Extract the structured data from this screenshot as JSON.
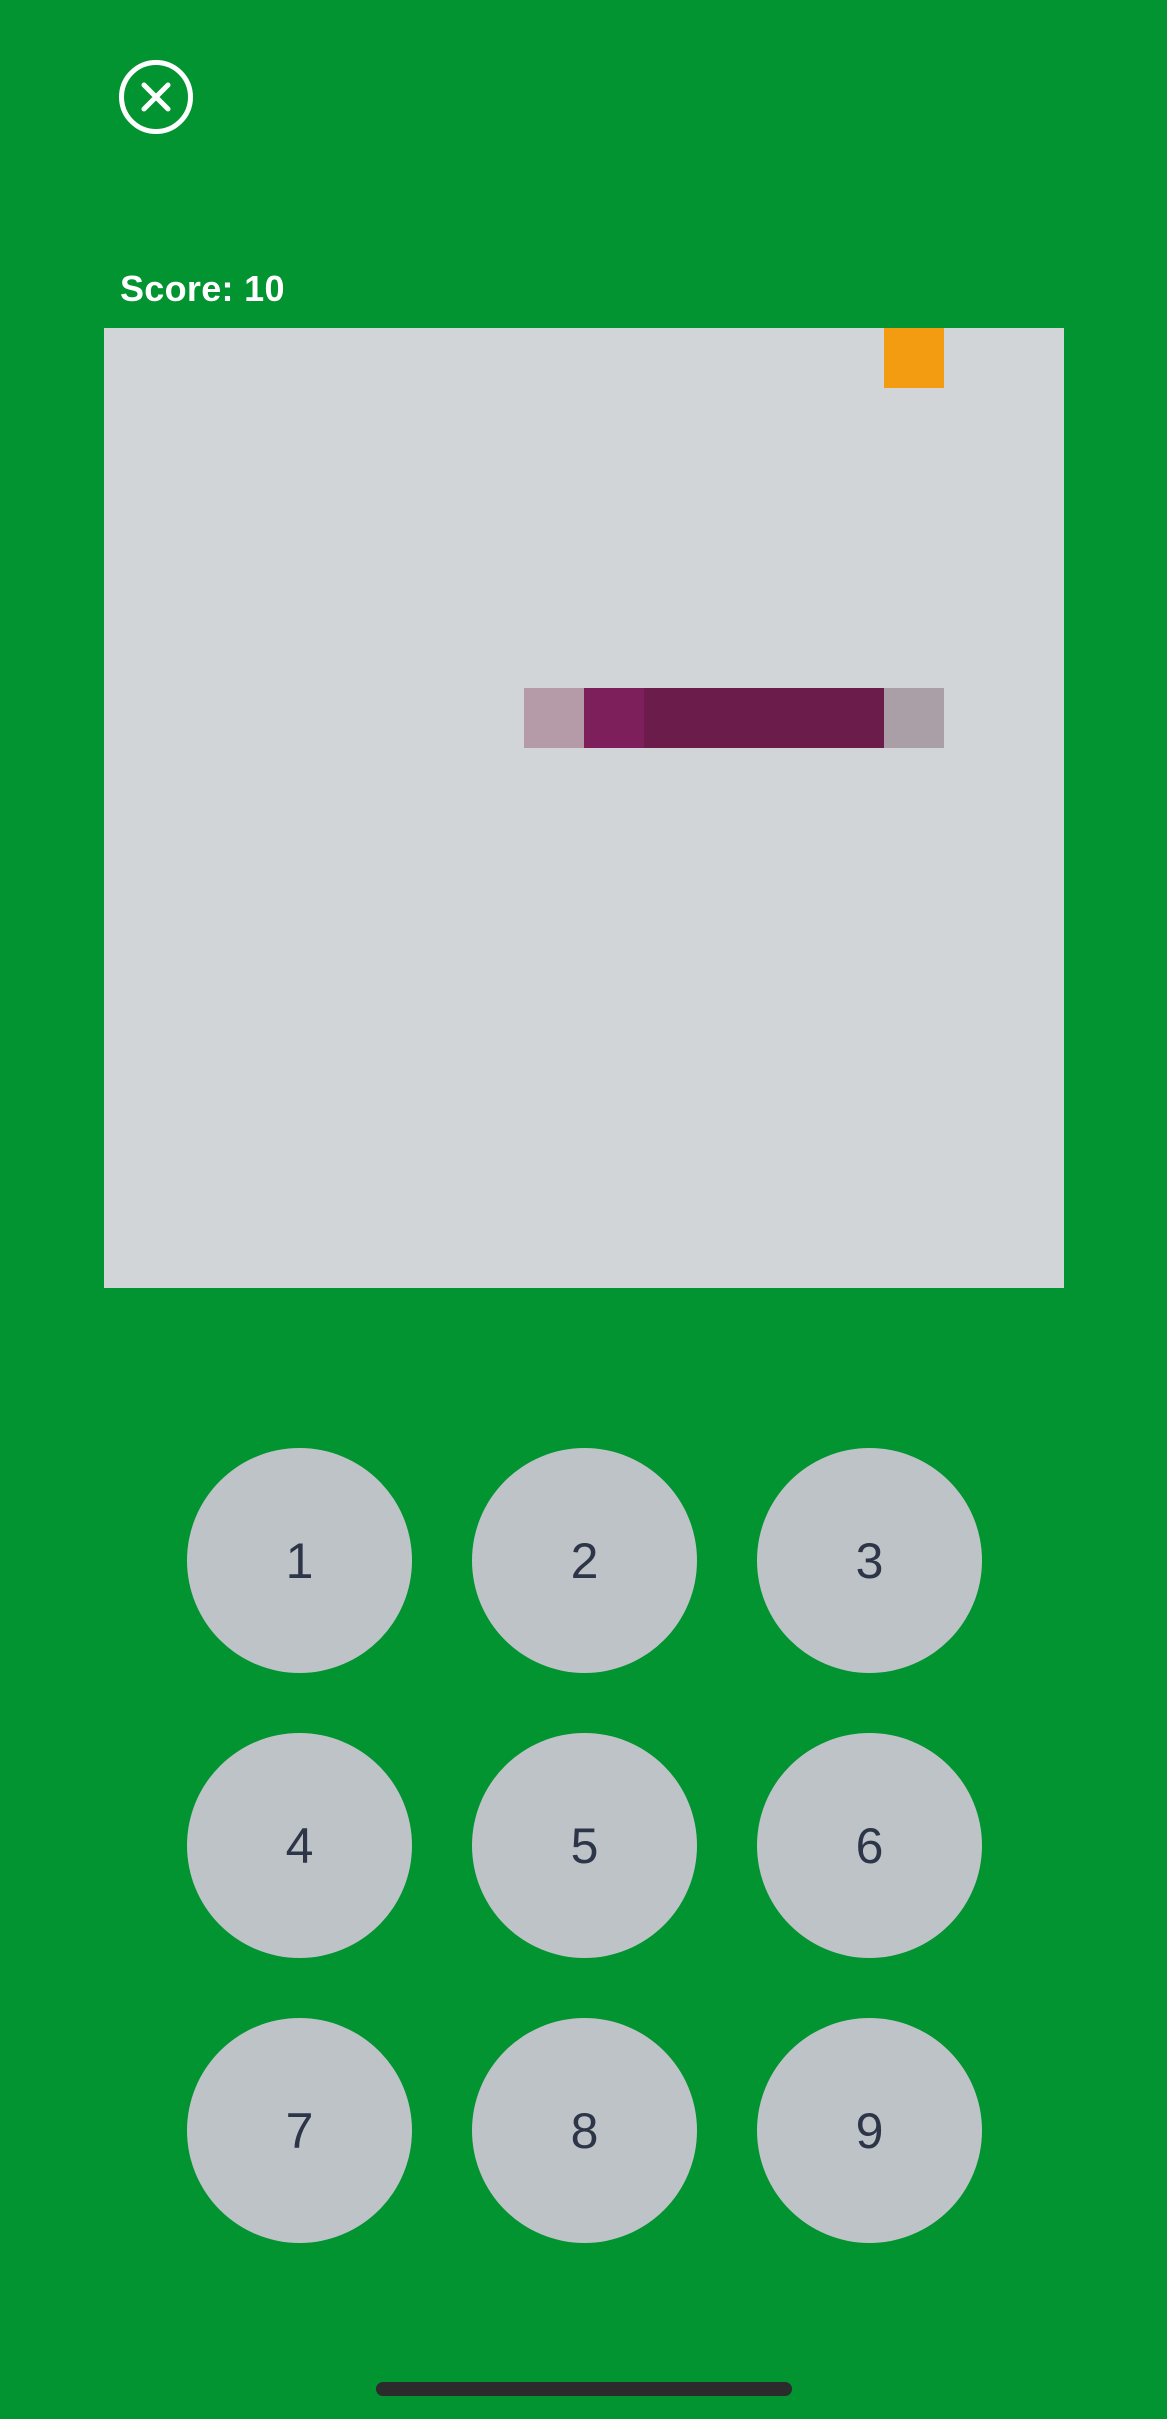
{
  "header": {
    "close_icon": "close-circle-icon",
    "score_text": "Score: 10"
  },
  "game": {
    "grid_size": 16,
    "food": {
      "col": 13,
      "row": 0,
      "color": "#f39c12"
    },
    "snake": [
      {
        "col": 7,
        "row": 6,
        "color": "#b59aa8"
      },
      {
        "col": 8,
        "row": 6,
        "color": "#7d1f5b"
      },
      {
        "col": 9,
        "row": 6,
        "color": "#6b1c4a"
      },
      {
        "col": 10,
        "row": 6,
        "color": "#6b1c4a"
      },
      {
        "col": 11,
        "row": 6,
        "color": "#6b1c4a"
      },
      {
        "col": 12,
        "row": 6,
        "color": "#6b1c4a"
      },
      {
        "col": 13,
        "row": 6,
        "color": "#aa9fa6"
      }
    ],
    "board_color": "#d1d5d7"
  },
  "keypad": {
    "keys": [
      "1",
      "2",
      "3",
      "4",
      "5",
      "6",
      "7",
      "8",
      "9"
    ]
  },
  "colors": {
    "background": "#019430",
    "key_bg": "#bec3c7",
    "key_text": "#2d3548"
  }
}
